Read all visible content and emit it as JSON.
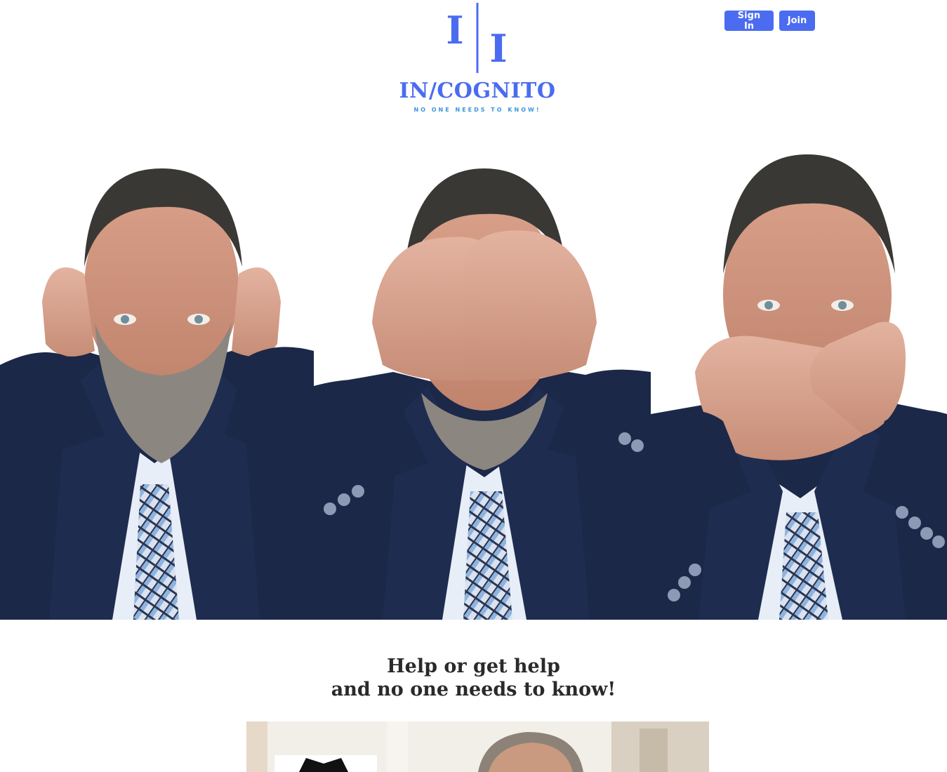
{
  "header": {
    "signin_label": "Sign In",
    "join_label": "Join"
  },
  "logo": {
    "mark_left": "I",
    "mark_right": "I",
    "title": "IN/COGNITO",
    "tagline": "NO ONE NEEDS TO KNOW!"
  },
  "hero": {
    "image": "three-men-hear-see-speak-no-evil"
  },
  "headline": {
    "line1": "Help or get help",
    "line2": "and no one needs to know!"
  },
  "teaser": {
    "image": "man-portrait-photo"
  },
  "colors": {
    "brand_blue": "#4b6cf0",
    "tagline_blue": "#3c95d9",
    "suit_navy": "#1b2848",
    "headline_text": "#2a2a2a"
  }
}
